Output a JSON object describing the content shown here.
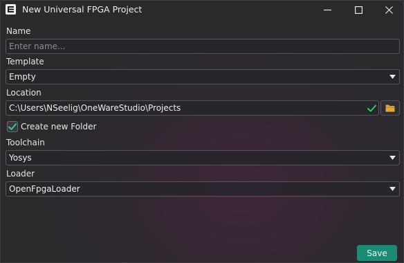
{
  "window": {
    "title": "New Universal FPGA Project",
    "icon": "app-logo-icon",
    "controls": [
      "minimize-icon",
      "maximize-icon",
      "close-icon"
    ]
  },
  "form": {
    "name": {
      "label": "Name",
      "value": "",
      "placeholder": "Enter name..."
    },
    "template": {
      "label": "Template",
      "selected": "Empty"
    },
    "location": {
      "label": "Location",
      "value": "C:\\Users\\NSeelig\\OneWareStudio\\Projects",
      "valid": true
    },
    "create_folder": {
      "label": "Create new Folder",
      "checked": true
    },
    "toolchain": {
      "label": "Toolchain",
      "selected": "Yosys"
    },
    "loader": {
      "label": "Loader",
      "selected": "OpenFpgaLoader"
    }
  },
  "actions": {
    "save_label": "Save"
  },
  "colors": {
    "accent": "#1d8b74",
    "valid_check": "#2ecc71",
    "folder_icon": "#e2a83a"
  }
}
